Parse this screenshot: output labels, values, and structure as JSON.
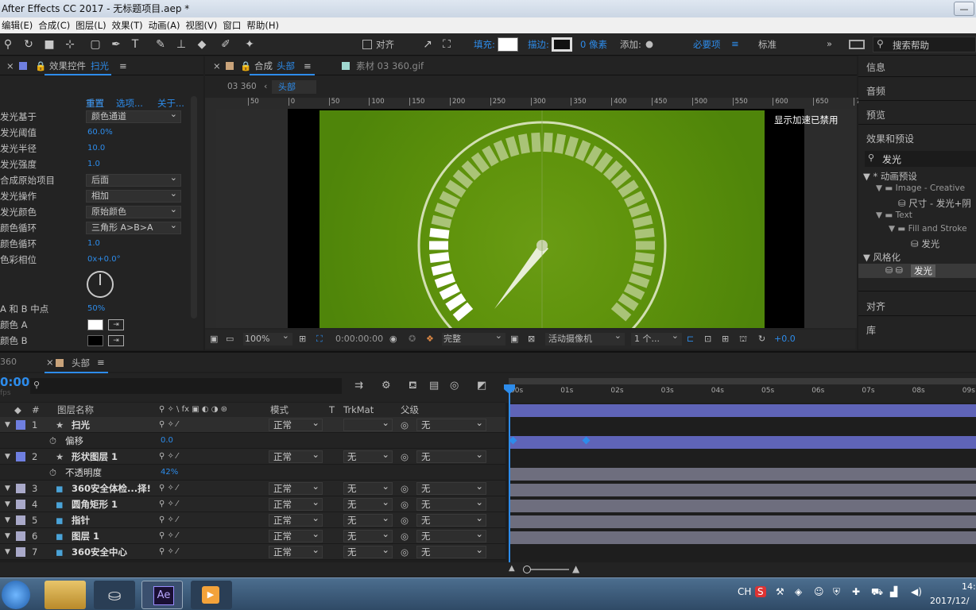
{
  "window": {
    "title": "After Effects CC 2017 - 无标题项目.aep *"
  },
  "menu": [
    "编辑(E)",
    "合成(C)",
    "图层(L)",
    "效果(T)",
    "动画(A)",
    "视图(V)",
    "窗口",
    "帮助(H)"
  ],
  "toolbar": {
    "snap_label": "对齐",
    "fill_label": "填充:",
    "stroke_label": "描边:",
    "stroke_px": "0 像素",
    "add_label": "添加:",
    "workspace_essentials": "必要项",
    "workspace_standard": "标准",
    "search_placeholder": "搜索帮助"
  },
  "effect_panel": {
    "title_prefix": "效果控件",
    "layer_name": "扫光",
    "reset": "重置",
    "options": "选项...",
    "about": "关于...",
    "props": [
      {
        "name": "发光基于",
        "value": "颜色通道",
        "kind": "dropdown"
      },
      {
        "name": "发光阈值",
        "value": "60.0%",
        "kind": "value"
      },
      {
        "name": "发光半径",
        "value": "10.0",
        "kind": "value"
      },
      {
        "name": "发光强度",
        "value": "1.0",
        "kind": "value"
      },
      {
        "name": "合成原始项目",
        "value": "后面",
        "kind": "dropdown"
      },
      {
        "name": "发光操作",
        "value": "相加",
        "kind": "dropdown"
      },
      {
        "name": "发光颜色",
        "value": "原始颜色",
        "kind": "dropdown"
      },
      {
        "name": "颜色循环",
        "value": "三角形 A>B>A",
        "kind": "dropdown"
      },
      {
        "name": "颜色循环",
        "value": "1.0",
        "kind": "value"
      },
      {
        "name": "色彩相位",
        "value": "0x+0.0°",
        "kind": "value"
      }
    ],
    "ab_mid": {
      "name": "A 和 B 中点",
      "value": "50%"
    },
    "color_a": "颜色 A",
    "color_b": "颜色 B"
  },
  "comp_panel": {
    "title": "合成",
    "comp_name": "头部",
    "footage_label": "素材 03 360.gif",
    "breadcrumb_parent": "03 360",
    "breadcrumb_current": "头部",
    "ruler_ticks": [
      "50",
      "0",
      "50",
      "100",
      "150",
      "200",
      "250",
      "300",
      "350",
      "400",
      "450",
      "500",
      "550",
      "600",
      "650",
      "70"
    ],
    "accel_notice": "显示加速已禁用",
    "viewbar": {
      "zoom": "100%",
      "timecode": "0:00:00:00",
      "resolution": "完整",
      "camera": "活动摄像机",
      "views": "1 个...",
      "exposure": "+0.0"
    }
  },
  "right_panel": {
    "info": "信息",
    "audio": "音频",
    "preview": "预览",
    "effects_presets": "效果和预设",
    "search_value": "发光",
    "tree": [
      {
        "label": "* 动画预设"
      },
      {
        "label": "Image - Creative"
      },
      {
        "label": "尺寸 - 发光+阴"
      },
      {
        "label": "Text"
      },
      {
        "label": "Fill and Stroke"
      },
      {
        "label": "发光"
      },
      {
        "label": "风格化"
      },
      {
        "label": "发光"
      }
    ],
    "align": "对齐",
    "library": "库"
  },
  "timeline": {
    "tab_prev": "360",
    "tab_name": "头部",
    "timecode": "0:00",
    "fps": "fps",
    "columns": {
      "layer_name": "图层名称",
      "mode": "模式",
      "t": "T",
      "trkmat": "TrkMat",
      "parent": "父级"
    },
    "ticks": [
      "00s",
      "01s",
      "02s",
      "03s",
      "04s",
      "05s",
      "06s",
      "07s",
      "08s",
      "09s"
    ],
    "layers": [
      {
        "num": "1",
        "name": "扫光",
        "mode": "正常",
        "trkmat": "",
        "parent": "无",
        "color": "#6f7fe0",
        "star": true
      },
      {
        "sub": true,
        "name": "偏移",
        "value": "0.0"
      },
      {
        "num": "2",
        "name": "形状图层 1",
        "mode": "正常",
        "trkmat": "无",
        "parent": "无",
        "color": "#6f7fe0",
        "star": true
      },
      {
        "sub": true,
        "name": "不透明度",
        "value": "42%"
      },
      {
        "num": "3",
        "name": "360安全体检...择!",
        "mode": "正常",
        "trkmat": "无",
        "parent": "无",
        "color": "#a9a9c9"
      },
      {
        "num": "4",
        "name": "圆角矩形 1",
        "mode": "正常",
        "trkmat": "无",
        "parent": "无",
        "color": "#a9a9c9"
      },
      {
        "num": "5",
        "name": "指针",
        "mode": "正常",
        "trkmat": "无",
        "parent": "无",
        "color": "#a9a9c9"
      },
      {
        "num": "6",
        "name": "图层 1",
        "mode": "正常",
        "trkmat": "无",
        "parent": "无",
        "color": "#a9a9c9"
      },
      {
        "num": "7",
        "name": "360安全中心",
        "mode": "正常",
        "trkmat": "无",
        "parent": "无",
        "color": "#a9a9c9"
      }
    ]
  },
  "taskbar": {
    "ime": "CH",
    "time": "14:",
    "date": "2017/12/"
  }
}
